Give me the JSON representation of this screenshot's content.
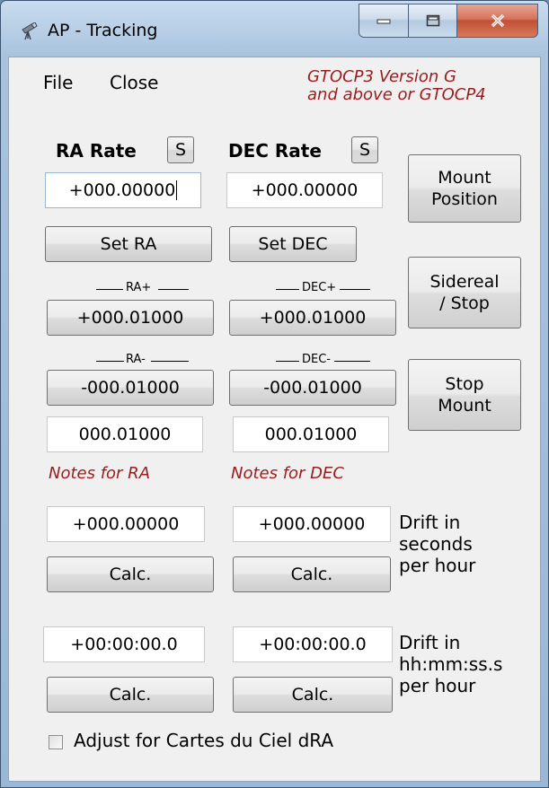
{
  "window": {
    "title": "AP - Tracking"
  },
  "menu": {
    "file": "File",
    "close": "Close"
  },
  "version_note": [
    "GTOCP3 Version G",
    "and above or GTOCP4"
  ],
  "ra": {
    "header": "RA Rate",
    "s_button": "S",
    "rate_value": "+000.00000",
    "set_button": "Set RA",
    "plus_label": "RA+",
    "plus_button": "+000.01000",
    "minus_label": "RA-",
    "minus_button": "-000.01000",
    "step_value": "000.01000",
    "notes": "Notes for RA",
    "drift_seconds_value": "+000.00000",
    "calc_seconds": "Calc.",
    "drift_hms_value": "+00:00:00.0",
    "calc_hms": "Calc."
  },
  "dec": {
    "header": "DEC Rate",
    "s_button": "S",
    "rate_value": "+000.00000",
    "set_button": "Set DEC",
    "plus_label": "DEC+",
    "plus_button": "+000.01000",
    "minus_label": "DEC-",
    "minus_button": "-000.01000",
    "step_value": "000.01000",
    "notes": "Notes for DEC",
    "drift_seconds_value": "+000.00000",
    "calc_seconds": "Calc.",
    "drift_hms_value": "+00:00:00.0",
    "calc_hms": "Calc."
  },
  "side_buttons": {
    "mount_position": [
      "Mount",
      "Position"
    ],
    "sidereal_stop": [
      "Sidereal",
      "/ Stop"
    ],
    "stop_mount": [
      "Stop",
      "Mount"
    ]
  },
  "drift_seconds_label": [
    "Drift in",
    "seconds",
    "per hour"
  ],
  "drift_hms_label": [
    "Drift in",
    "hh:mm:ss.s",
    "per hour"
  ],
  "cartes_checkbox": {
    "label": "Adjust for Cartes du Ciel dRA",
    "checked": false
  },
  "colors": {
    "note_red": "#9b1c1c",
    "titlebar": "#a9c3de",
    "close_red": "#c14f35"
  },
  "icons": {
    "app": "telescope-icon",
    "minimize": "minimize-icon",
    "maximize": "maximize-icon",
    "close": "close-icon"
  }
}
